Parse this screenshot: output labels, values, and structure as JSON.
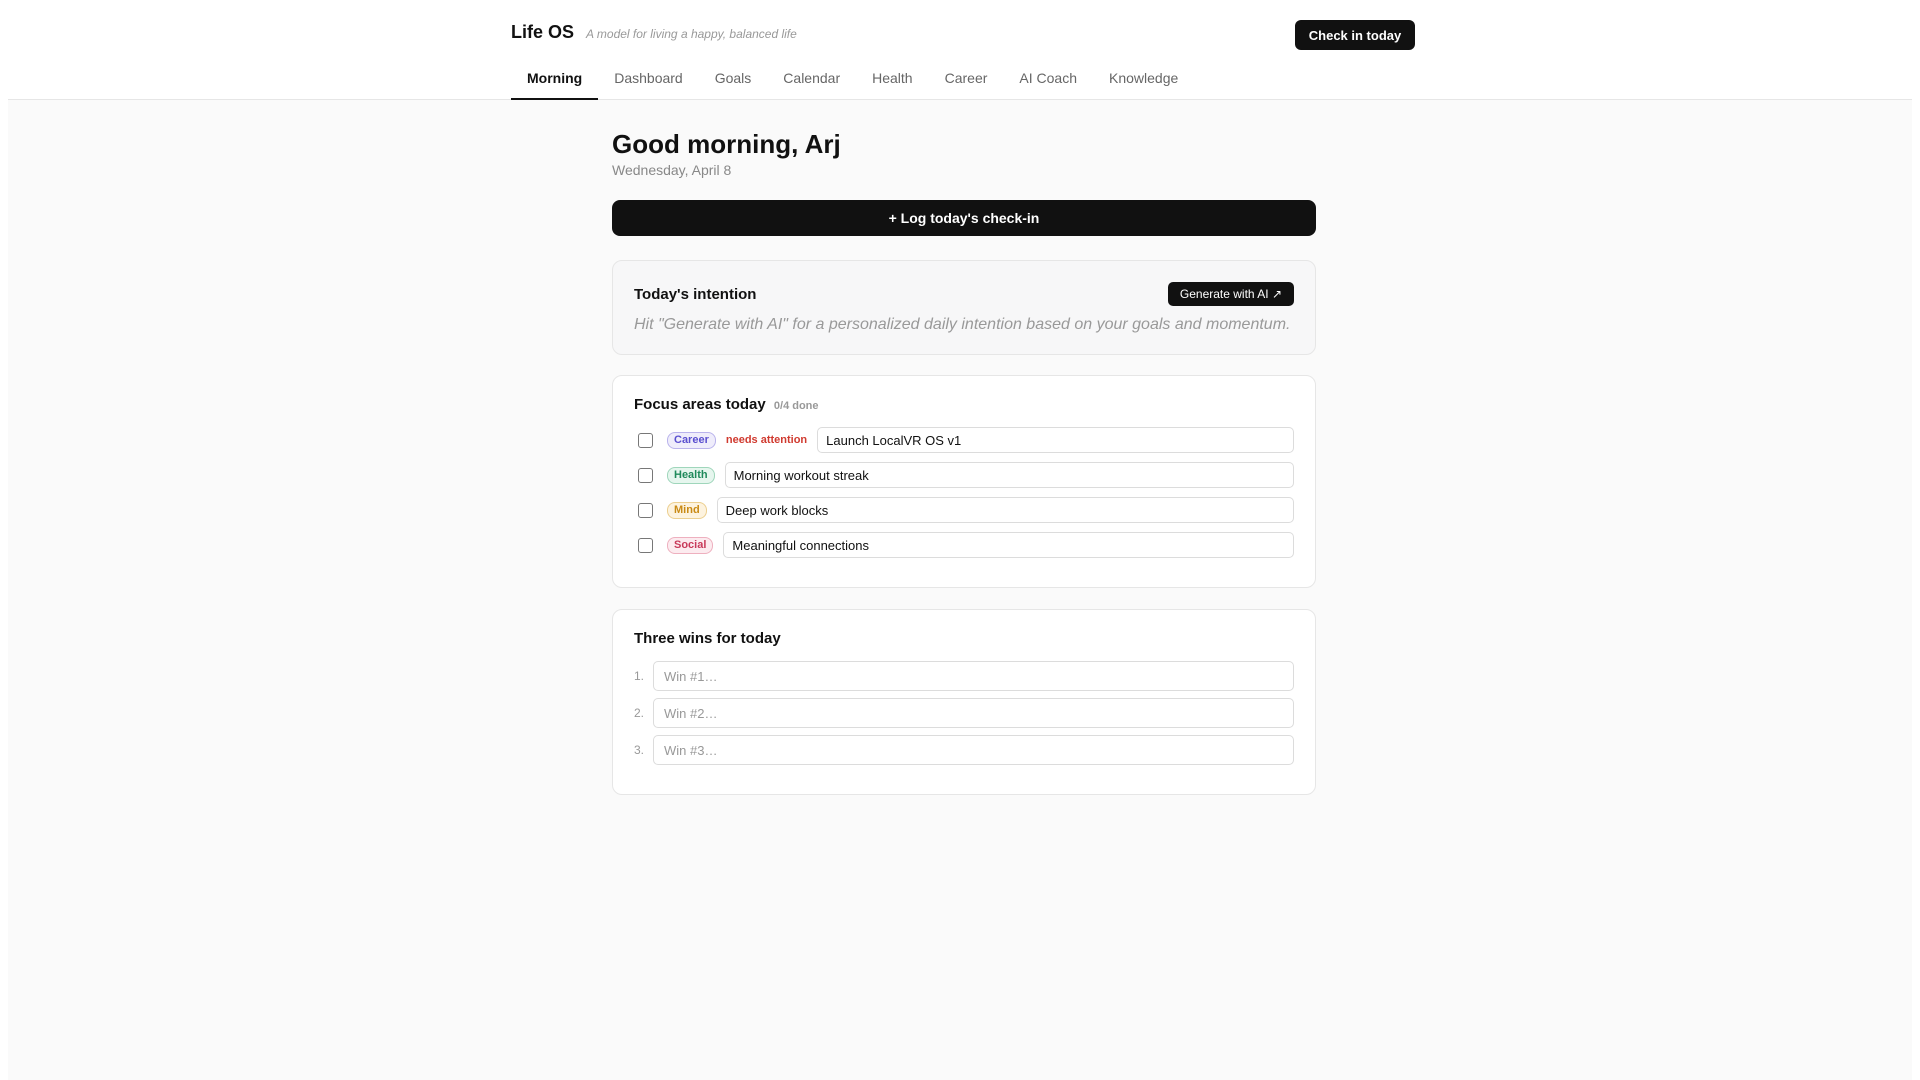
{
  "header": {
    "title": "Life OS",
    "tagline": "A model for living a happy, balanced life",
    "checkin_label": "Check in today"
  },
  "tabs": [
    {
      "label": "Morning",
      "active": true
    },
    {
      "label": "Dashboard"
    },
    {
      "label": "Goals"
    },
    {
      "label": "Calendar"
    },
    {
      "label": "Health"
    },
    {
      "label": "Career"
    },
    {
      "label": "AI Coach"
    },
    {
      "label": "Knowledge"
    }
  ],
  "greeting": {
    "title": "Good morning, Arj",
    "date": "Wednesday, April 8"
  },
  "log_button_label": "+ Log today's check-in",
  "intention": {
    "title": "Today's intention",
    "generate_label": "Generate with AI ↗",
    "hint": "Hit \"Generate with AI\" for a personalized daily intention based on your goals and momentum."
  },
  "focus": {
    "title": "Focus areas today",
    "count": "0/4 done",
    "items": [
      {
        "tag": "Career",
        "note": "needs attention",
        "value": "Launch LocalVR OS v1",
        "checked": false
      },
      {
        "tag": "Health",
        "note": "",
        "value": "Morning workout streak",
        "checked": false
      },
      {
        "tag": "Mind",
        "note": "",
        "value": "Deep work blocks",
        "checked": false
      },
      {
        "tag": "Social",
        "note": "",
        "value": "Meaningful connections",
        "checked": false
      }
    ]
  },
  "wins": {
    "title": "Three wins for today",
    "items": [
      {
        "num": "1.",
        "placeholder": "Win #1…",
        "value": ""
      },
      {
        "num": "2.",
        "placeholder": "Win #2…",
        "value": ""
      },
      {
        "num": "3.",
        "placeholder": "Win #3…",
        "value": ""
      }
    ]
  },
  "colors": {
    "primary": "#111111",
    "attention": "#d03a2f",
    "career_tag": "#5a4fcf",
    "health_tag": "#1f8a5b",
    "mind_tag": "#c98a14",
    "social_tag": "#c83a5a"
  }
}
